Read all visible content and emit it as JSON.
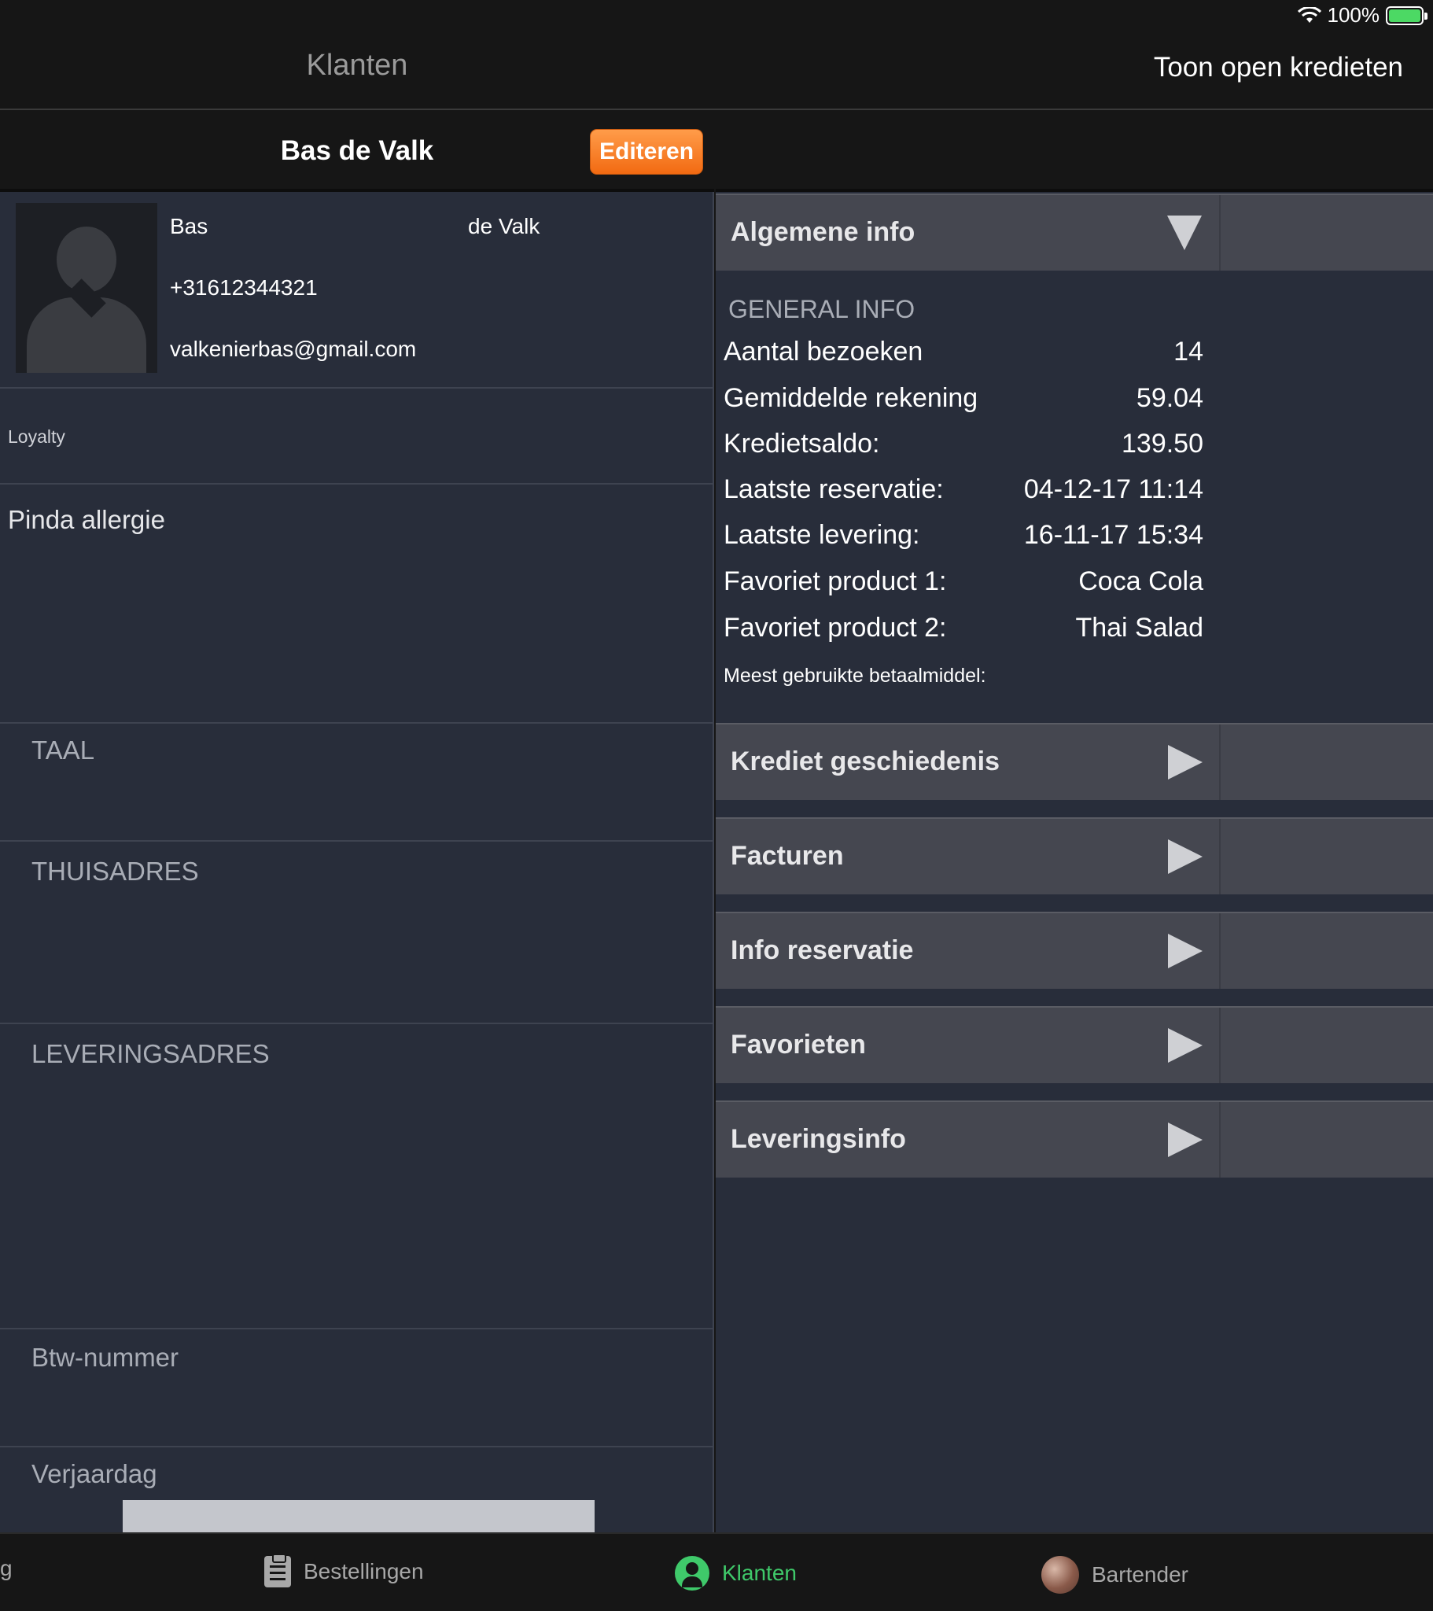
{
  "status_bar": {
    "battery": "100%"
  },
  "nav": {
    "title": "Klanten",
    "right_action": "Toon open kredieten"
  },
  "customer": {
    "header_title": "Bas de Valk",
    "edit_label": "Editeren",
    "first_name": "Bas",
    "last_name": "de Valk",
    "phone": "+31612344321",
    "email": "valkenierbas@gmail.com",
    "loyalty_label": "Loyalty",
    "note": "Pinda allergie",
    "sections": {
      "language": "TAAL",
      "home_address": "THUISADRES",
      "delivery_address": "LEVERINGSADRES",
      "vat": "Btw-nummer",
      "birthday": "Verjaardag"
    }
  },
  "accordion": {
    "general": "Algemene info",
    "credit_history": "Krediet geschiedenis",
    "invoices": "Facturen",
    "reservation_info": "Info reservatie",
    "favorites": "Favorieten",
    "delivery_info": "Leveringsinfo"
  },
  "general_info": {
    "heading": "GENERAL INFO",
    "rows": [
      {
        "label": "Aantal bezoeken",
        "value": "14"
      },
      {
        "label": "Gemiddelde rekening",
        "value": "59.04"
      },
      {
        "label": "Kredietsaldo:",
        "value": "139.50"
      },
      {
        "label": "Laatste reservatie:",
        "value": "04-12-17 11:14"
      },
      {
        "label": "Laatste levering:",
        "value": "16-11-17 15:34"
      },
      {
        "label": "Favoriet product 1:",
        "value": "Coca Cola"
      },
      {
        "label": "Favoriet product 2:",
        "value": "Thai Salad"
      }
    ],
    "payment_label": "Meest gebruikte betaalmiddel:"
  },
  "tabbar": {
    "partial": "g",
    "orders": "Bestellingen",
    "customers": "Klanten",
    "bartender": "Bartender"
  },
  "colors": {
    "accent_orange": "#f26a12",
    "active_green": "#3fc96a",
    "panel": "#282d3a"
  }
}
